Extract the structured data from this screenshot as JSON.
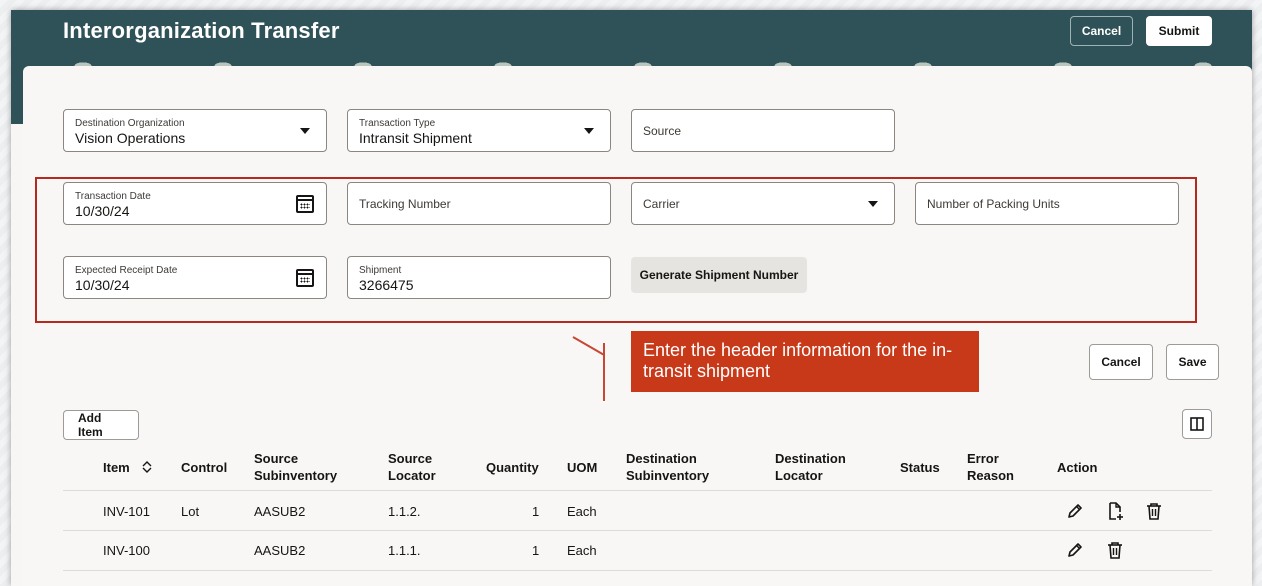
{
  "header": {
    "title": "Interorganization Transfer",
    "cancel_label": "Cancel",
    "submit_label": "Submit"
  },
  "fields": {
    "destination_org": {
      "label": "Destination Organization",
      "value": "Vision Operations"
    },
    "transaction_type": {
      "label": "Transaction Type",
      "value": "Intransit Shipment"
    },
    "source": {
      "placeholder": "Source"
    },
    "transaction_date": {
      "label": "Transaction Date",
      "value": "10/30/24"
    },
    "tracking_number": {
      "placeholder": "Tracking Number"
    },
    "carrier": {
      "placeholder": "Carrier"
    },
    "packing_units": {
      "placeholder": "Number of Packing Units"
    },
    "expected_receipt_date": {
      "label": "Expected Receipt Date",
      "value": "10/30/24"
    },
    "shipment": {
      "label": "Shipment",
      "value": "3266475"
    },
    "generate_label": "Generate Shipment Number"
  },
  "callout": {
    "text": "Enter the header information for the in-transit shipment"
  },
  "actions": {
    "cancel_label": "Cancel",
    "save_label": "Save",
    "add_item_label": "Add Item"
  },
  "table": {
    "columns": [
      "Item",
      "Control",
      "Source Subinventory",
      "Source Locator",
      "Quantity",
      "UOM",
      "Destination Subinventory",
      "Destination Locator",
      "Status",
      "Error Reason",
      "Action"
    ],
    "rows": [
      {
        "item": "INV-101",
        "control": "Lot",
        "source_subinventory": "AASUB2",
        "source_locator": "1.1.2.",
        "quantity": "1",
        "uom": "Each"
      },
      {
        "item": "INV-100",
        "control": "",
        "source_subinventory": "AASUB2",
        "source_locator": "1.1.1.",
        "quantity": "1",
        "uom": "Each"
      }
    ]
  },
  "colors": {
    "banner": "#2f5258",
    "highlight": "#b42a1e",
    "callout": "#c8391a"
  },
  "icons": [
    "calendar-icon",
    "chevron-down-icon",
    "edit-icon",
    "add-detail-icon",
    "delete-icon",
    "columns-icon",
    "sort-icon"
  ]
}
